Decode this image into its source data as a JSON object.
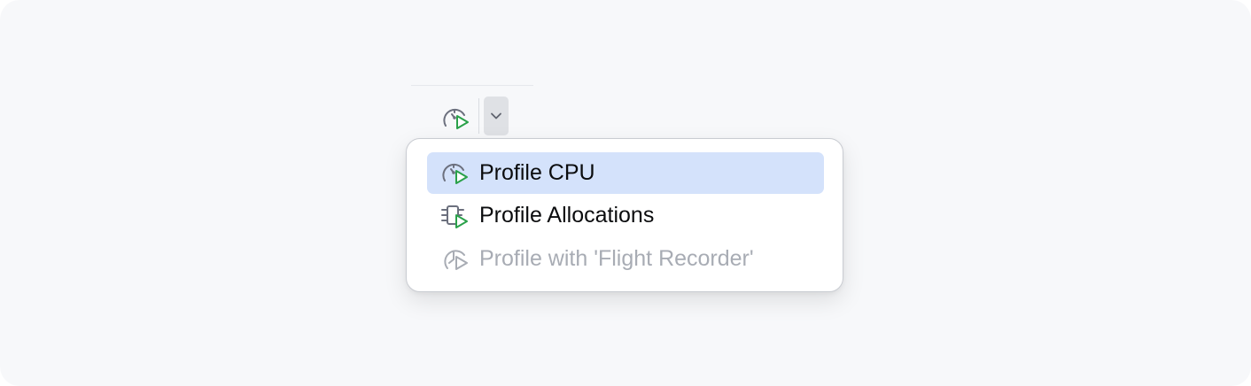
{
  "toolbar": {
    "profile_icon": "profile-cpu-icon",
    "dropdown_icon": "chevron-down-icon"
  },
  "menu": {
    "items": [
      {
        "label": "Profile CPU",
        "icon": "profile-cpu-icon",
        "state": "selected"
      },
      {
        "label": "Profile Allocations",
        "icon": "profile-allocations-icon",
        "state": "enabled"
      },
      {
        "label": "Profile with 'Flight Recorder'",
        "icon": "flight-recorder-icon",
        "state": "disabled"
      }
    ]
  },
  "colors": {
    "background": "#f7f8fa",
    "selection": "#d4e2fb",
    "run_green": "#2aa14a",
    "icon_gray": "#6c707e",
    "disabled_text": "#a8acb4"
  }
}
